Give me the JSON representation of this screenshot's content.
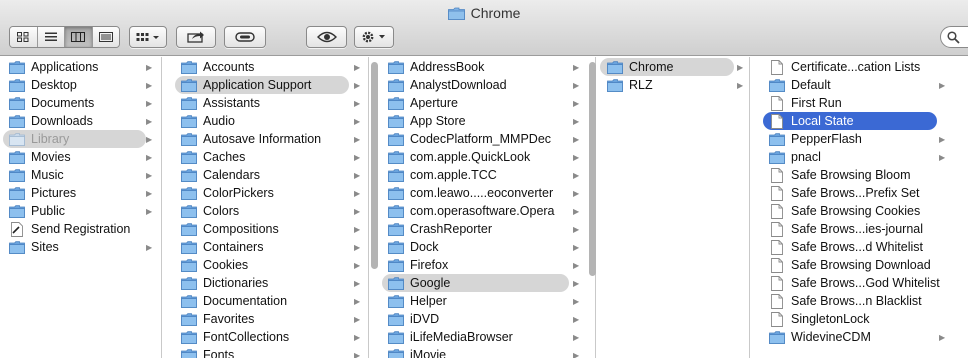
{
  "window": {
    "title": "Chrome"
  },
  "toolbar": {
    "view_buttons": [
      "icon-view",
      "list-view",
      "column-view",
      "cover-flow-view"
    ],
    "arrange": "arrange-menu",
    "share": "share",
    "tags": "tags",
    "quicklook": "quick-look",
    "action": "action-menu"
  },
  "columns": [
    {
      "name": "sidebar",
      "items": [
        {
          "label": "Applications",
          "icon": "apps-folder",
          "arrow": true
        },
        {
          "label": "Desktop",
          "icon": "desktop-folder",
          "arrow": true
        },
        {
          "label": "Documents",
          "icon": "documents-folder",
          "arrow": true
        },
        {
          "label": "Downloads",
          "icon": "downloads-folder",
          "arrow": true
        },
        {
          "label": "Library",
          "icon": "library-folder",
          "arrow": true,
          "state": "selected-dim"
        },
        {
          "label": "Movies",
          "icon": "movies-folder",
          "arrow": true
        },
        {
          "label": "Music",
          "icon": "music-folder",
          "arrow": true
        },
        {
          "label": "Pictures",
          "icon": "pictures-folder",
          "arrow": true
        },
        {
          "label": "Public",
          "icon": "public-folder",
          "arrow": true
        },
        {
          "label": "Send Registration",
          "icon": "file",
          "arrow": false
        },
        {
          "label": "Sites",
          "icon": "sites-folder",
          "arrow": true
        }
      ]
    },
    {
      "name": "library",
      "items": [
        {
          "label": "Accounts",
          "arrow": true
        },
        {
          "label": "Application Support",
          "arrow": true,
          "state": "selected"
        },
        {
          "label": "Assistants",
          "arrow": true
        },
        {
          "label": "Audio",
          "arrow": true
        },
        {
          "label": "Autosave Information",
          "arrow": true
        },
        {
          "label": "Caches",
          "arrow": true
        },
        {
          "label": "Calendars",
          "arrow": true
        },
        {
          "label": "ColorPickers",
          "arrow": true
        },
        {
          "label": "Colors",
          "arrow": true
        },
        {
          "label": "Compositions",
          "arrow": true
        },
        {
          "label": "Containers",
          "arrow": true
        },
        {
          "label": "Cookies",
          "arrow": true
        },
        {
          "label": "Dictionaries",
          "arrow": true
        },
        {
          "label": "Documentation",
          "arrow": true
        },
        {
          "label": "Favorites",
          "arrow": true
        },
        {
          "label": "FontCollections",
          "arrow": true
        },
        {
          "label": "Fonts",
          "arrow": true
        }
      ]
    },
    {
      "name": "application-support",
      "items": [
        {
          "label": "AddressBook",
          "arrow": true
        },
        {
          "label": "AnalystDownload",
          "arrow": true
        },
        {
          "label": "Aperture",
          "arrow": true
        },
        {
          "label": "App Store",
          "arrow": true
        },
        {
          "label": "CodecPlatform_MMPDec",
          "arrow": true
        },
        {
          "label": "com.apple.QuickLook",
          "arrow": true
        },
        {
          "label": "com.apple.TCC",
          "arrow": true
        },
        {
          "label": "com.leawo.....eoconverter",
          "arrow": true
        },
        {
          "label": "com.operasoftware.Opera",
          "arrow": true
        },
        {
          "label": "CrashReporter",
          "arrow": true
        },
        {
          "label": "Dock",
          "arrow": true
        },
        {
          "label": "Firefox",
          "arrow": true
        },
        {
          "label": "Google",
          "arrow": true,
          "state": "selected"
        },
        {
          "label": "Helper",
          "arrow": true
        },
        {
          "label": "iDVD",
          "arrow": true
        },
        {
          "label": "iLifeMediaBrowser",
          "arrow": true
        },
        {
          "label": "iMovie",
          "arrow": true
        }
      ]
    },
    {
      "name": "google",
      "items": [
        {
          "label": "Chrome",
          "arrow": true,
          "state": "selected"
        },
        {
          "label": "RLZ",
          "arrow": true
        }
      ]
    },
    {
      "name": "chrome",
      "items": [
        {
          "label": "Certificate...cation Lists",
          "icon": "file",
          "arrow": false
        },
        {
          "label": "Default",
          "icon": "folder",
          "arrow": true
        },
        {
          "label": "First Run",
          "icon": "file",
          "arrow": false
        },
        {
          "label": "Local State",
          "icon": "file",
          "arrow": false,
          "state": "selected-blue"
        },
        {
          "label": "PepperFlash",
          "icon": "folder",
          "arrow": true
        },
        {
          "label": "pnacl",
          "icon": "folder",
          "arrow": true
        },
        {
          "label": "Safe Browsing Bloom",
          "icon": "file",
          "arrow": false
        },
        {
          "label": "Safe Brows...Prefix Set",
          "icon": "file",
          "arrow": false
        },
        {
          "label": "Safe Browsing Cookies",
          "icon": "file",
          "arrow": false
        },
        {
          "label": "Safe Brows...ies-journal",
          "icon": "file",
          "arrow": false
        },
        {
          "label": "Safe Brows...d Whitelist",
          "icon": "file",
          "arrow": false
        },
        {
          "label": "Safe Browsing Download",
          "icon": "file",
          "arrow": false
        },
        {
          "label": "Safe Brows...God Whitelist",
          "icon": "file",
          "arrow": false,
          "display": "Safe Brows...God Whitelist"
        },
        {
          "label": "Safe Brows...n Blacklist",
          "icon": "file",
          "arrow": false
        },
        {
          "label": "SingletonLock",
          "icon": "file",
          "arrow": false
        },
        {
          "label": "WidevineCDM",
          "icon": "folder",
          "arrow": true
        }
      ]
    }
  ],
  "colors": {
    "folder": "#7fb2e5",
    "folder_dark": "#5b93cf",
    "selection_blue": "#3b69d4",
    "selection_gray": "#d6d6d6"
  }
}
